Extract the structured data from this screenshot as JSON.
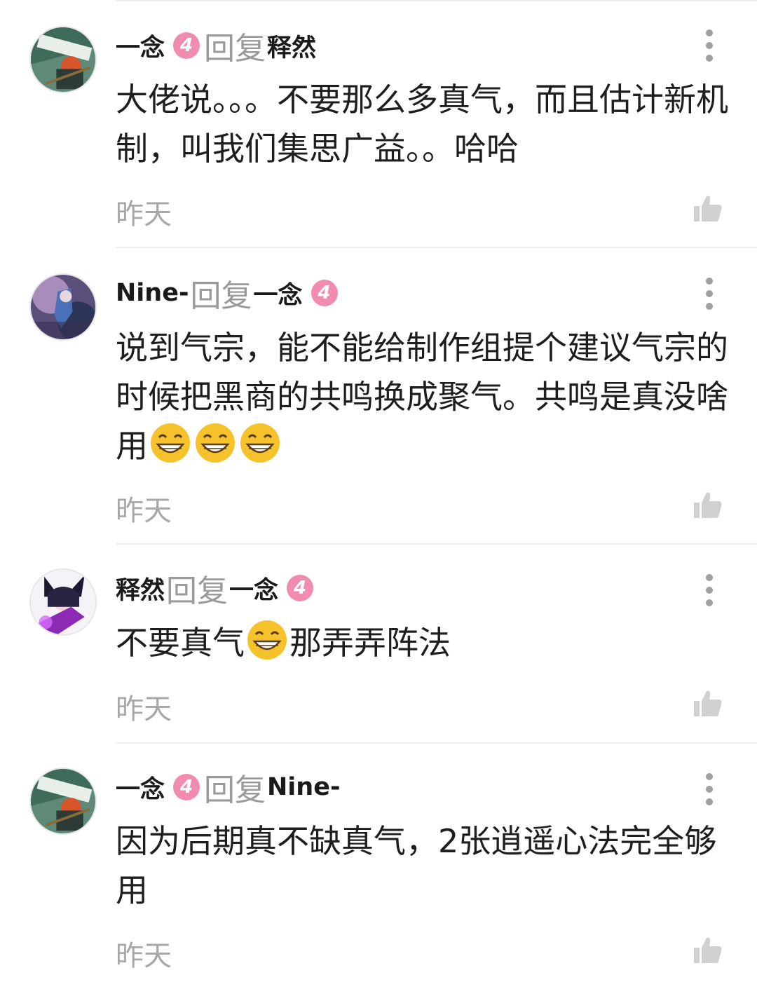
{
  "comments": [
    {
      "author": "一念",
      "level": "4",
      "reply_label": "回复",
      "reply_to": "释然",
      "reply_to_level": "",
      "text": "大佬说。。。不要那么多真气，而且估计新机制，叫我们集思广益。。哈哈",
      "time": "昨天"
    },
    {
      "author": "Nine-",
      "level": "",
      "reply_label": "回复",
      "reply_to": "一念",
      "reply_to_level": "4",
      "text_lines": [
        "说到气宗，能不能给制作组提个建议气宗的时候把黑商的共鸣换成聚气。共鸣是真没啥用"
      ],
      "emojis": [
        "grin-emoji",
        "grin-emoji",
        "grin-emoji"
      ],
      "time": "昨天"
    },
    {
      "author": "释然",
      "level": "",
      "reply_label": "回复",
      "reply_to": "一念",
      "reply_to_level": "4",
      "text_before_emoji": "不要真气",
      "text_after_emoji": "那弄弄阵法",
      "time": "昨天"
    },
    {
      "author": "一念",
      "level": "4",
      "reply_label": "回复",
      "reply_to": "Nine-",
      "reply_to_level": "",
      "text": "因为后期真不缺真气，2张逍遥心法完全够用",
      "time": "昨天"
    }
  ],
  "colors": {
    "badge": "#f08cb0",
    "username": "#1a1a1a",
    "secondary_text": "#a8a8a8",
    "icon": "#d0d0d0"
  }
}
